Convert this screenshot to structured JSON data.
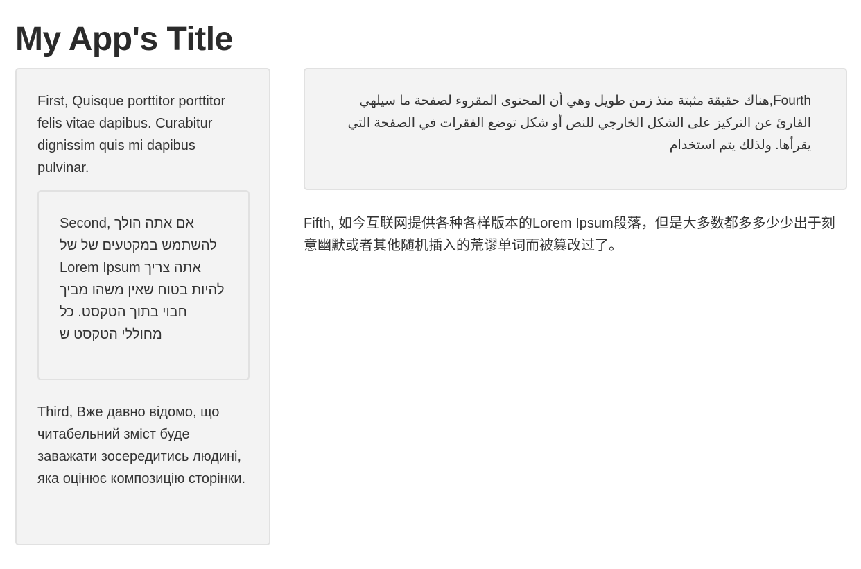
{
  "app": {
    "title": "My App's Title"
  },
  "sidebar": {
    "first": "First, Quisque porttitor porttitor felis vitae dapibus. Curabitur dignissim quis mi dapibus pulvinar.",
    "second": "Second, אם אתה הולך להשתמש במקטעים של של Lorem Ipsum אתה צריך להיות בטוח שאין משהו מביך חבוי בתוך הטקסט. כל מחוללי הטקסט ש",
    "third": "Third, Вже давно відомо, що читабельний зміст буде заважати зосередитись людині, яка оцінює композицію сторінки."
  },
  "main": {
    "fourth": "Fourth,هناك حقيقة مثبتة منذ زمن طويل وهي أن المحتوى المقروء لصفحة ما سيلهي القارئ عن التركيز على الشكل الخارجي للنص أو شكل توضع الفقرات في الصفحة التي يقرأها. ولذلك يتم استخدام",
    "fifth": "Fifth, 如今互联网提供各种各样版本的Lorem Ipsum段落，但是大多数都多多少少出于刻意幽默或者其他随机插入的荒谬单词而被篡改过了。"
  },
  "colors": {
    "well_background": "#f3f3f3",
    "well_border": "#e1e1e1",
    "text": "#333333",
    "title": "#2b2b2b"
  }
}
